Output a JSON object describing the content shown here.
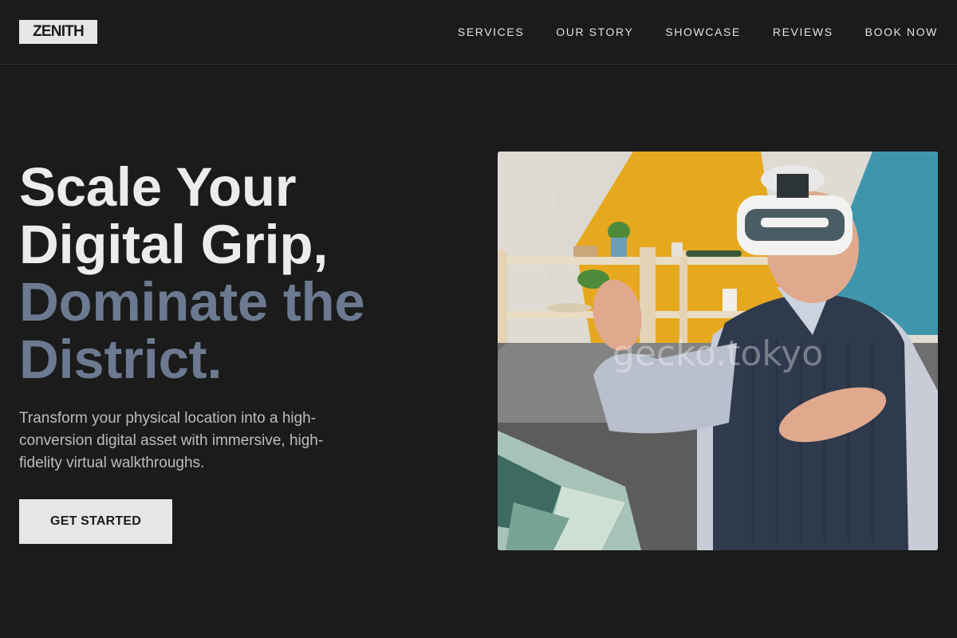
{
  "brand": {
    "name": "ZENITH"
  },
  "nav": {
    "items": [
      {
        "label": "SERVICES"
      },
      {
        "label": "OUR STORY"
      },
      {
        "label": "SHOWCASE"
      },
      {
        "label": "REVIEWS"
      },
      {
        "label": "BOOK NOW"
      }
    ]
  },
  "hero": {
    "headline_lines": [
      "Scale Your",
      "Digital Grip,",
      "Dominate the",
      "District."
    ],
    "subtitle": "Transform your physical location into a high-conversion digital asset with immersive, high-fidelity virtual walkthroughs.",
    "cta_label": "GET STARTED",
    "image_alt": "Senior man on a sofa wearing a VR headset, reaching out with both hands",
    "watermark": "gecko.tokyo"
  },
  "colors": {
    "background": "#1b1b1b",
    "text": "#ececec",
    "accent": "#6b7a90",
    "button_bg": "#e6e6e6"
  }
}
